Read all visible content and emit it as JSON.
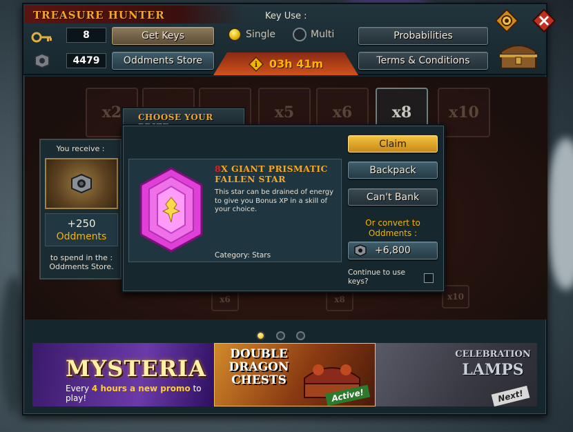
{
  "window": {
    "title": "TREASURE HUNTER",
    "keys_count": "8",
    "get_keys_label": "Get Keys",
    "oddments_count": "4479",
    "oddments_store_label": "Oddments Store",
    "key_use_label": "Key Use :",
    "single_label": "Single",
    "multi_label": "Multi",
    "selected_key_use": "Single",
    "timer": "03h 41m",
    "probabilities_label": "Probabilities",
    "terms_label": "Terms & Conditions"
  },
  "tiles": [
    "x2",
    "",
    "",
    "x5",
    "x6",
    "x8",
    "x10"
  ],
  "small_tiles": [
    "x6",
    "x8",
    "x10"
  ],
  "receive": {
    "label": "You receive :",
    "amount": "+250",
    "currency": "Oddments",
    "note": "to spend in the : Oddments Store."
  },
  "prize": {
    "tab_title": "CHOOSE YOUR PRIZE",
    "quantity": "8",
    "name": "X GIANT PRISMATIC FALLEN STAR",
    "description": "This star can be drained of energy to give you Bonus XP in a skill of your choice.",
    "category": "Category: Stars",
    "claim_label": "Claim",
    "backpack_label": "Backpack",
    "cant_bank_label": "Can't Bank",
    "convert_label": "Or convert to Oddments :",
    "convert_value": "+6,800",
    "continue_label": "Continue to use keys?"
  },
  "carousel": {
    "active_index": 0,
    "banners": [
      {
        "title": "MYSTERIA",
        "subtitle_pre": "Every ",
        "subtitle_bold": "4 hours a new promo",
        "subtitle_post": " to play!"
      },
      {
        "title": "DOUBLE DRAGON CHESTS",
        "badge": "Active!"
      },
      {
        "title_small": "CELEBRATION",
        "title": "LAMPS",
        "badge": "Next!"
      }
    ]
  },
  "colors": {
    "title_gold": "#f5a623",
    "accent_red": "#e02020",
    "claim_gold": "#e7a92a",
    "oddments_yellow": "#f5b400"
  }
}
